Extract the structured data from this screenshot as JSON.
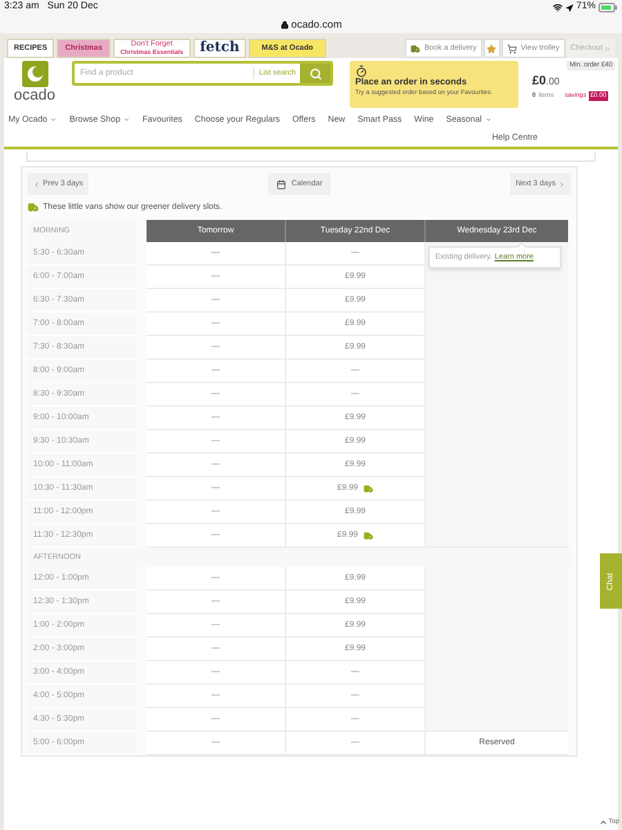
{
  "status_bar": {
    "time": "3:23 am",
    "date": "Sun 20 Dec",
    "battery": "71%"
  },
  "address_bar": {
    "url": "ocado.com"
  },
  "promo_tabs": [
    {
      "label": "RECIPES",
      "kind": "plain"
    },
    {
      "label": "Christmas",
      "kind": "pink"
    },
    {
      "label": "Don't Forget",
      "sublabel": "Christmas Essentials",
      "kind": "two-line"
    },
    {
      "label": "fetch",
      "kind": "logo"
    },
    {
      "label": "M&S at Ocado",
      "kind": "yellow"
    }
  ],
  "header_actions": [
    {
      "label": "Book a delivery",
      "kind": "van"
    },
    {
      "kind": "star"
    },
    {
      "label": "View trolley",
      "kind": "trolley"
    },
    {
      "label": "Checkout",
      "kind": "checkout"
    }
  ],
  "logo": {
    "wordmark": "ocado"
  },
  "search": {
    "placeholder": "Find a product",
    "list_search": "List search"
  },
  "promo": {
    "title": "Place an order in seconds",
    "text": "Try a suggested order based on your Favourites."
  },
  "trolley": {
    "min_order": "Min. order £40",
    "total": "£0",
    "total_pence": ".00",
    "items_count": "0",
    "items_label": "items",
    "savings_label": "savings",
    "savings": "£0.00"
  },
  "nav": [
    {
      "label": "My Ocado",
      "dropdown": true
    },
    {
      "label": "Browse Shop",
      "dropdown": true
    },
    {
      "label": "Favourites",
      "dropdown": false
    },
    {
      "label": "Choose your Regulars",
      "dropdown": false
    },
    {
      "label": "Offers",
      "dropdown": false
    },
    {
      "label": "New",
      "dropdown": false
    },
    {
      "label": "Smart Pass",
      "dropdown": false
    },
    {
      "label": "Wine",
      "dropdown": false
    },
    {
      "label": "Seasonal",
      "dropdown": true
    }
  ],
  "help": "Help Centre",
  "slots": {
    "prev": "Prev 3 days",
    "calendar": "Calendar",
    "next": "Next 3 days",
    "green_note": "These little vans show our greener delivery slots.",
    "days": [
      "Tomorrow",
      "Tuesday 22nd Dec",
      "Wednesday 23rd Dec"
    ],
    "tooltip": {
      "text": "Existing delivery.",
      "link": "Learn more"
    },
    "sections": [
      {
        "label": "MORNING",
        "rows": [
          {
            "time": "5:30 - 6:30am",
            "cells": [
              {
                "text": "—"
              },
              {
                "text": "—"
              }
            ]
          },
          {
            "time": "6:00 - 7:00am",
            "cells": [
              {
                "text": "—"
              },
              {
                "text": "£9.99",
                "green": false
              }
            ]
          },
          {
            "time": "6:30 - 7:30am",
            "cells": [
              {
                "text": "—"
              },
              {
                "text": "£9.99",
                "green": false
              }
            ]
          },
          {
            "time": "7:00 - 8:00am",
            "cells": [
              {
                "text": "—"
              },
              {
                "text": "£9.99",
                "green": false
              }
            ]
          },
          {
            "time": "7:30 - 8:30am",
            "cells": [
              {
                "text": "—"
              },
              {
                "text": "£9.99",
                "green": false
              }
            ]
          },
          {
            "time": "8:00 - 9:00am",
            "cells": [
              {
                "text": "—"
              },
              {
                "text": "—"
              }
            ]
          },
          {
            "time": "8:30 - 9:30am",
            "cells": [
              {
                "text": "—"
              },
              {
                "text": "—"
              }
            ]
          },
          {
            "time": "9:00 - 10:00am",
            "cells": [
              {
                "text": "—"
              },
              {
                "text": "£9.99",
                "green": false
              }
            ]
          },
          {
            "time": "9:30 - 10:30am",
            "cells": [
              {
                "text": "—"
              },
              {
                "text": "£9.99",
                "green": false
              }
            ]
          },
          {
            "time": "10:00 - 11:00am",
            "cells": [
              {
                "text": "—"
              },
              {
                "text": "£9.99",
                "green": false
              }
            ]
          },
          {
            "time": "10:30 - 11:30am",
            "cells": [
              {
                "text": "—"
              },
              {
                "text": "£9.99",
                "green": true
              }
            ]
          },
          {
            "time": "11:00 - 12:00pm",
            "cells": [
              {
                "text": "—"
              },
              {
                "text": "£9.99",
                "green": false
              }
            ]
          },
          {
            "time": "11:30 - 12:30pm",
            "cells": [
              {
                "text": "—"
              },
              {
                "text": "£9.99",
                "green": true
              }
            ]
          }
        ]
      },
      {
        "label": "AFTERNOON",
        "rows": [
          {
            "time": "12:00 - 1:00pm",
            "cells": [
              {
                "text": "—"
              },
              {
                "text": "£9.99",
                "green": false
              }
            ]
          },
          {
            "time": "12:30 - 1:30pm",
            "cells": [
              {
                "text": "—"
              },
              {
                "text": "£9.99",
                "green": false
              }
            ]
          },
          {
            "time": "1:00 - 2:00pm",
            "cells": [
              {
                "text": "—"
              },
              {
                "text": "£9.99",
                "green": false
              }
            ]
          },
          {
            "time": "2:00 - 3:00pm",
            "cells": [
              {
                "text": "—"
              },
              {
                "text": "£9.99",
                "green": false
              }
            ]
          },
          {
            "time": "3:00 - 4:00pm",
            "cells": [
              {
                "text": "—"
              },
              {
                "text": "—"
              }
            ]
          },
          {
            "time": "4:00 - 5:00pm",
            "cells": [
              {
                "text": "—"
              },
              {
                "text": "—"
              }
            ]
          },
          {
            "time": "4:30 - 5:30pm",
            "cells": [
              {
                "text": "—"
              },
              {
                "text": "—"
              }
            ]
          },
          {
            "time": "5:00 - 6:00pm",
            "cells": [
              {
                "text": "—"
              },
              {
                "text": "—"
              },
              {
                "text": "Reserved"
              }
            ]
          }
        ]
      }
    ]
  },
  "chat": "Chat",
  "top": "Top"
}
